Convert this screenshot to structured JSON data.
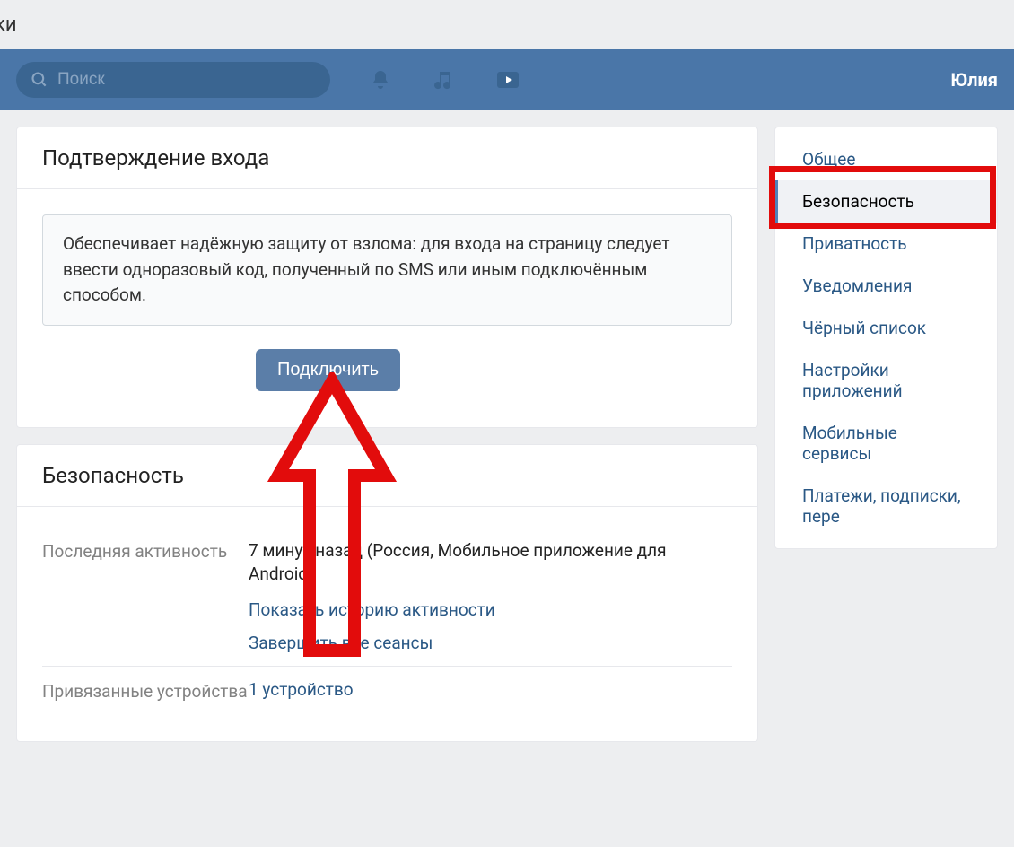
{
  "top_strip_fragment": "ки",
  "search": {
    "placeholder": "Поиск"
  },
  "header": {
    "username": "Юлия"
  },
  "card1": {
    "title": "Подтверждение входа",
    "info": "Обеспечивает надёжную защиту от взлома: для входа на страницу следует ввести одноразовый код, полученный по SMS или иным подключённым способом.",
    "connect_btn": "Подключить"
  },
  "card2": {
    "title": "Безопасность",
    "rows": {
      "last_activity_label": "Последняя активность",
      "last_activity_value": "7 минут назад (Россия, Мобильное приложение для Android)",
      "show_history": "Показать историю активности",
      "end_sessions": "Завершить все сеансы",
      "devices_label": "Привязанные устройства",
      "devices_value": "1 устройство"
    }
  },
  "sidebar": {
    "items": [
      {
        "label": "Общее"
      },
      {
        "label": "Безопасность",
        "active": true
      },
      {
        "label": "Приватность"
      },
      {
        "label": "Уведомления"
      },
      {
        "label": "Чёрный список"
      },
      {
        "label": "Настройки приложений"
      },
      {
        "label": "Мобильные сервисы"
      },
      {
        "label": "Платежи, подписки, пере"
      }
    ]
  },
  "annotation_colors": {
    "highlight": "#e20c0c"
  }
}
